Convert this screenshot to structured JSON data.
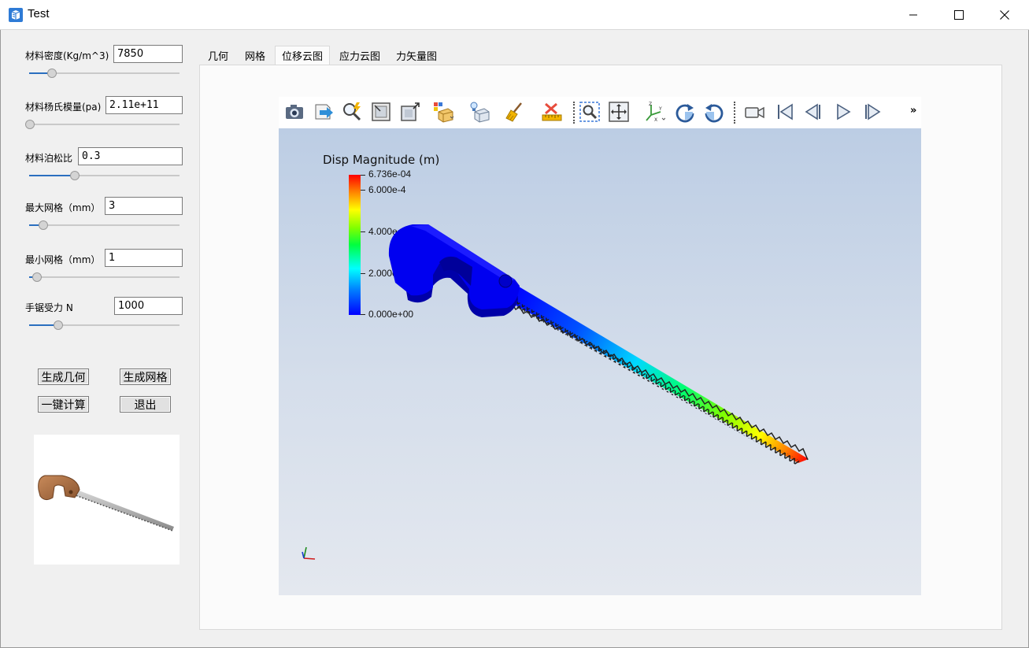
{
  "window": {
    "title": "Test",
    "icon": "app-cube-icon",
    "controls": [
      "minimize-icon",
      "maximize-icon",
      "close-icon"
    ]
  },
  "params": {
    "density": {
      "label": "材料密度(Kg/m^3)",
      "value": "7850",
      "slider": 0.15
    },
    "youngs": {
      "label": "材料杨氏模量(pa)",
      "value": "2.11e+11",
      "slider": 0.0
    },
    "poisson": {
      "label": "材料泊松比",
      "value": "0.3",
      "slider": 0.3
    },
    "max_mesh": {
      "label": "最大网格（mm）",
      "value": "3",
      "slider": 0.09
    },
    "min_mesh": {
      "label": "最小网格（mm）",
      "value": "1",
      "slider": 0.05
    },
    "force": {
      "label": "手锯受力 N",
      "value": "1000",
      "slider": 0.19
    }
  },
  "buttons": {
    "gen_geometry": "生成几何",
    "gen_mesh": "生成网格",
    "compute": "一键计算",
    "exit": "退出"
  },
  "tabs": [
    {
      "label": "几何",
      "active": false
    },
    {
      "label": "网格",
      "active": false
    },
    {
      "label": "位移云图",
      "active": true
    },
    {
      "label": "应力云图",
      "active": false
    },
    {
      "label": "力矢量图",
      "active": false
    }
  ],
  "toolbar": {
    "icons": [
      "camera-icon",
      "export-icon",
      "zoom-data-icon",
      "reset-camera-icon",
      "zoom-box-icon",
      "select-cells-icon",
      "select-points-icon",
      "clear-selection-icon",
      "ruler-icon",
      "zoom-closest-icon",
      "pan-icon",
      "axes-orient-icon",
      "rotate-cw-icon",
      "rotate-ccw-icon",
      "video-camera-icon",
      "first-frame-icon",
      "prev-frame-icon",
      "play-icon",
      "next-frame-icon"
    ],
    "more": "»"
  },
  "viewer": {
    "legend_title": "Disp Magnitude (m)",
    "legend_labels": [
      "6.736e-04",
      "6.000e-4",
      "4.000e-4",
      "2.000e-4",
      "0.000e+00"
    ],
    "legend_range": [
      0,
      0.0006736
    ],
    "colors": {
      "max": "#ff0000",
      "min": "#0000ff",
      "background_top": "#bccde4",
      "background_bottom": "#e4e8ef"
    }
  }
}
